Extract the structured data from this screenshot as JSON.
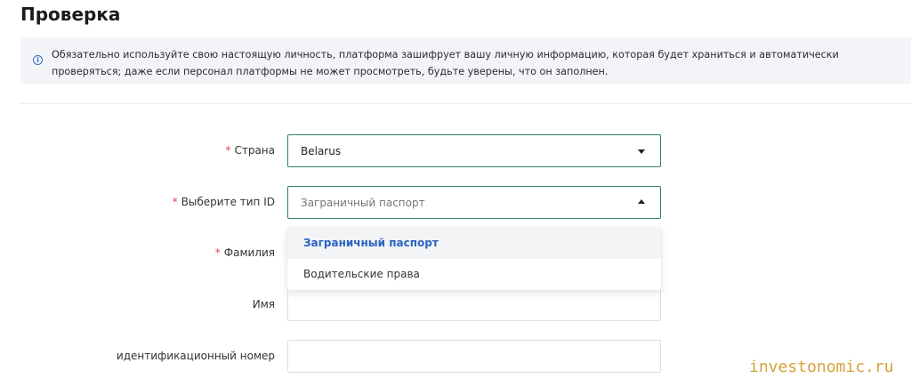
{
  "page": {
    "title": "Проверка",
    "notice": "Обязательно используйте свою настоящую личность, платформа зашифрует вашу личную информацию, которая будет храниться и автоматически проверяться; даже если персонал платформы не может просмотреть, будьте уверены, что он заполнен."
  },
  "form": {
    "country": {
      "label": "Страна",
      "required": true,
      "value": "Belarus"
    },
    "id_type": {
      "label": "Выберите тип ID",
      "required": true,
      "placeholder": "Заграничный паспорт"
    },
    "surname": {
      "label": "Фамилия",
      "required": true,
      "value": ""
    },
    "name": {
      "label": "Имя",
      "required": false,
      "value": ""
    },
    "id_number": {
      "label": "идентификационный номер",
      "required": false,
      "value": ""
    }
  },
  "dropdown": {
    "options": [
      "Заграничный паспорт",
      "Водительские права"
    ],
    "selected_index": 0
  },
  "watermark": "investonomic.ru",
  "colors": {
    "accent": "#2d7f6a",
    "required": "#e0474c",
    "link": "#2a62c2"
  }
}
